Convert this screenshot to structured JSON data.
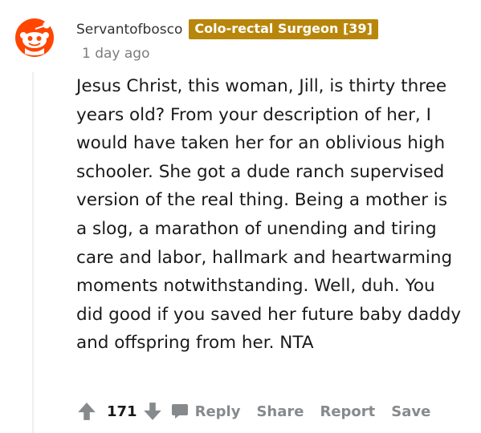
{
  "comment": {
    "username": "Servantofbosco",
    "flair": "Colo-rectal Surgeon [39]",
    "timestamp": "1 day ago",
    "body": "Jesus Christ, this woman, Jill, is thirty three years old? From your description of her, I would have taken her for an oblivious high schooler. She got a dude ranch supervised version of the real thing. Being a mother is a slog, a marathon of unending and tiring care and labor, hallmark and heartwarming moments notwithstanding. Well, duh. You did good if you saved her future baby daddy and offspring from her. NTA"
  },
  "actions": {
    "score": "171",
    "reply_label": "Reply",
    "share_label": "Share",
    "report_label": "Report",
    "save_label": "Save"
  },
  "colors": {
    "flair_bg": "#b8860b",
    "avatar_red": "#ff4500",
    "action_gray": "#878a8c"
  }
}
